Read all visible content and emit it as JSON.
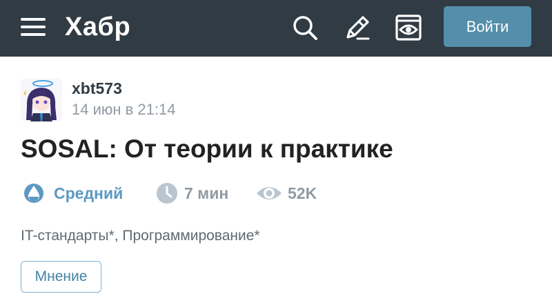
{
  "header": {
    "logo": "Хабр",
    "login_label": "Войти",
    "icons": [
      "menu-icon",
      "search-icon",
      "write-icon",
      "reading-mode-icon"
    ],
    "bg_color": "#303b44",
    "login_color": "#548eaa"
  },
  "post": {
    "author": "xbt573",
    "date": "14 июн в 21:14",
    "title": "SOSAL: От теории к практике",
    "difficulty": "Средний",
    "read_time": "7 мин",
    "views": "52K",
    "hubs": [
      "IT-стандарты*",
      "Программирование*"
    ],
    "hub_separator": ", ",
    "tag": "Мнение",
    "accent_color": "#5c99c1"
  }
}
